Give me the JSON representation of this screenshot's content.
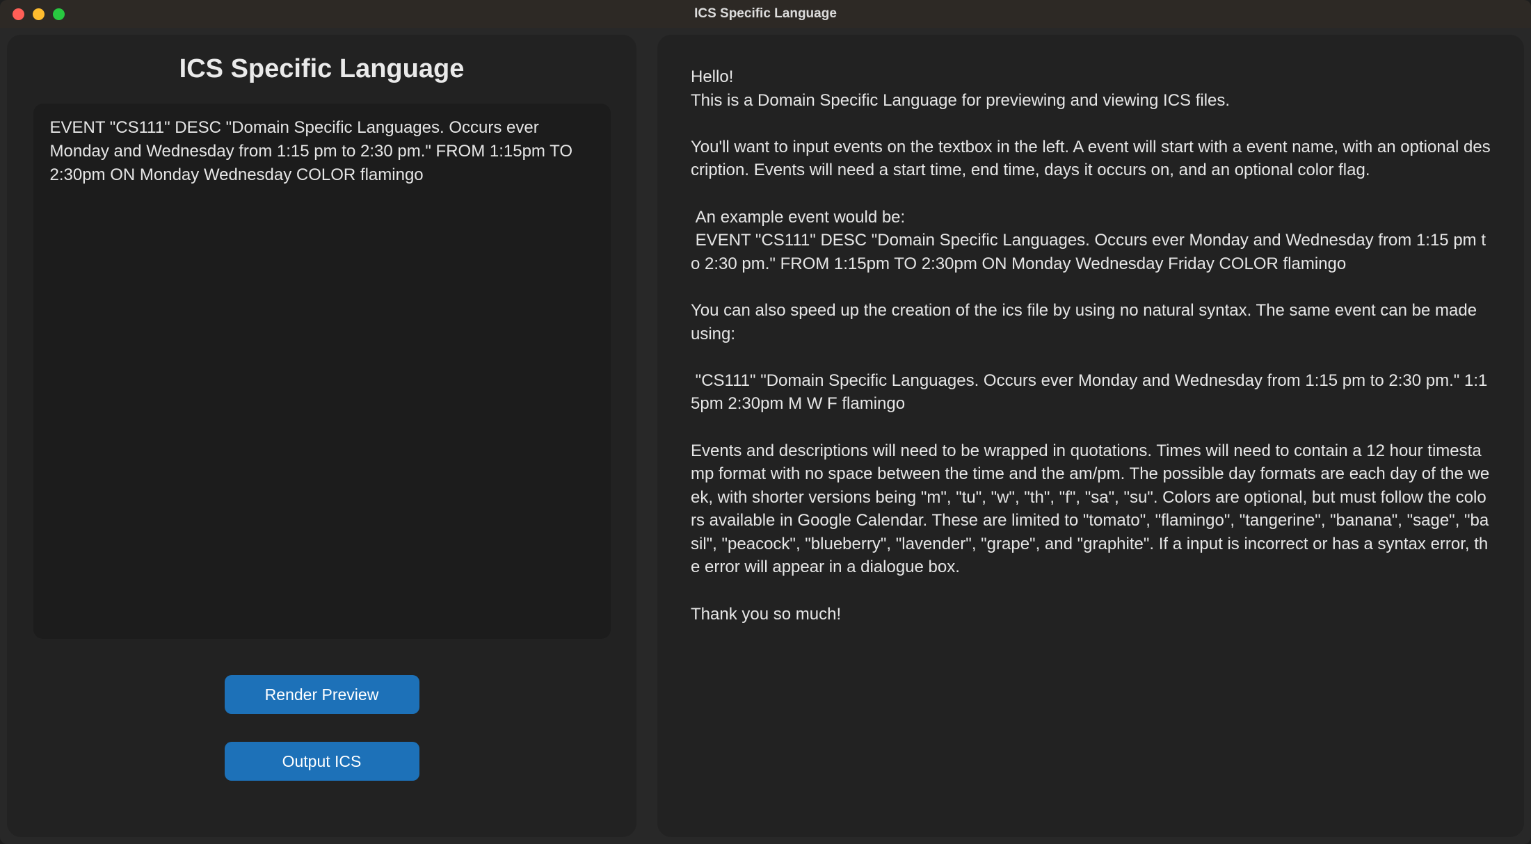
{
  "window": {
    "title": "ICS Specific Language"
  },
  "leftPanel": {
    "heading": "ICS Specific Language",
    "inputText": "EVENT \"CS111\" DESC \"Domain Specific Languages. Occurs ever Monday and Wednesday from 1:15 pm to 2:30 pm.\" FROM 1:15pm TO 2:30pm ON Monday Wednesday COLOR flamingo",
    "buttons": {
      "renderPreview": "Render Preview",
      "outputIcs": "Output ICS"
    }
  },
  "rightPanel": {
    "helpText": "Hello!\nThis is a Domain Specific Language for previewing and viewing ICS files.\n\nYou'll want to input events on the textbox in the left. A event will start with a event name, with an optional description. Events will need a start time, end time, days it occurs on, and an optional color flag.\n\n An example event would be:\n EVENT \"CS111\" DESC \"Domain Specific Languages. Occurs ever Monday and Wednesday from 1:15 pm to 2:30 pm.\" FROM 1:15pm TO 2:30pm ON Monday Wednesday Friday COLOR flamingo\n\nYou can also speed up the creation of the ics file by using no natural syntax. The same event can be made using:\n\n \"CS111\" \"Domain Specific Languages. Occurs ever Monday and Wednesday from 1:15 pm to 2:30 pm.\" 1:15pm 2:30pm M W F flamingo\n\nEvents and descriptions will need to be wrapped in quotations. Times will need to contain a 12 hour timestamp format with no space between the time and the am/pm. The possible day formats are each day of the week, with shorter versions being \"m\", \"tu\", \"w\", \"th\", \"f\", \"sa\", \"su\". Colors are optional, but must follow the colors available in Google Calendar. These are limited to \"tomato\", \"flamingo\", \"tangerine\", \"banana\", \"sage\", \"basil\", \"peacock\", \"blueberry\", \"lavender\", \"grape\", and \"graphite\". If a input is incorrect or has a syntax error, the error will appear in a dialogue box.\n\nThank you so much!"
  }
}
